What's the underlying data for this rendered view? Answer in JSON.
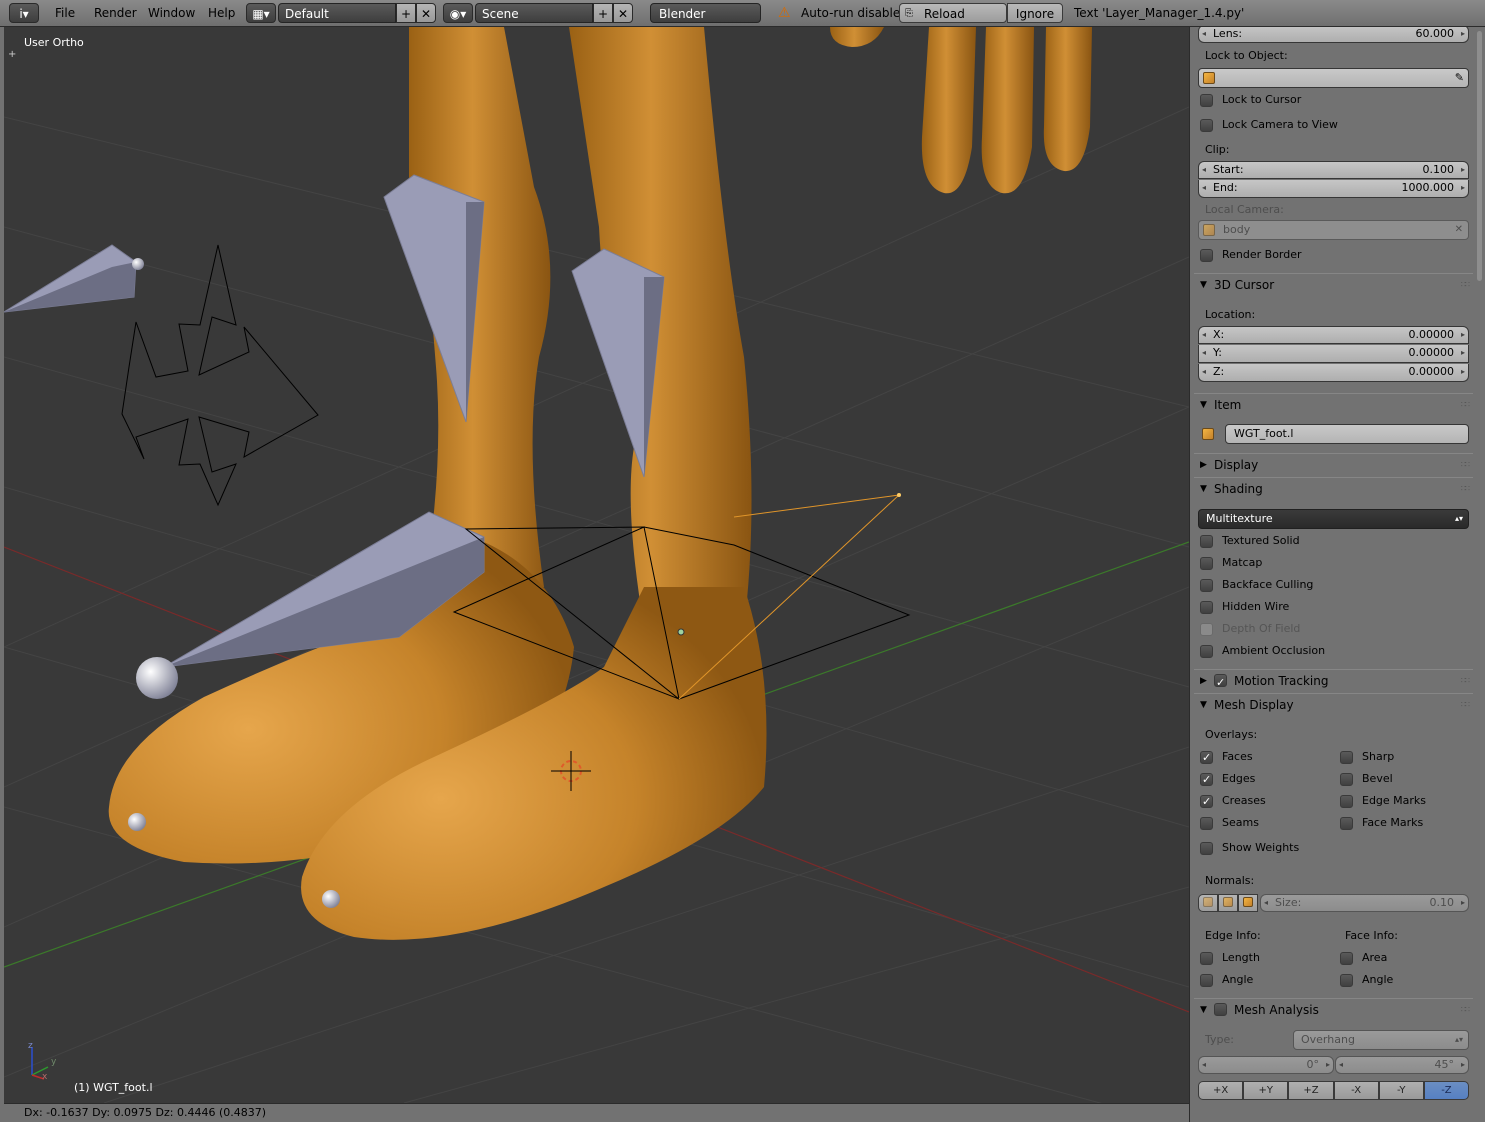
{
  "header": {
    "info_icon": "i",
    "menus": [
      "File",
      "Render",
      "Window",
      "Help"
    ],
    "screen_layout": "Default",
    "scene": "Scene",
    "render_engine": "Blender Render",
    "warning_text": "Auto-run disabled",
    "reload_trusted": "Reload Trusted",
    "ignore": "Ignore",
    "text_message": "Text 'Layer_Manager_1.4.py'"
  },
  "viewport": {
    "view_label": "User Ortho",
    "object_label": "(1) WGT_foot.l",
    "axis_y": "y",
    "axis_x": "x",
    "axis_z": "z",
    "status": "Dx: -0.1637  Dy: 0.0975  Dz: 0.4446 (0.4837)"
  },
  "properties": {
    "lens_label": "Lens:",
    "lens_value": "60.000",
    "lock_to_object_label": "Lock to Object:",
    "lock_to_cursor": "Lock to Cursor",
    "lock_camera_to_view": "Lock Camera to View",
    "clip_label": "Clip:",
    "clip_start_label": "Start:",
    "clip_start_value": "0.100",
    "clip_end_label": "End:",
    "clip_end_value": "1000.000",
    "local_camera_label": "Local Camera:",
    "local_camera_value": "body",
    "render_border": "Render Border",
    "cursor_section": "3D Cursor",
    "location_label": "Location:",
    "x_label": "X:",
    "x_value": "0.00000",
    "y_label": "Y:",
    "y_value": "0.00000",
    "z_label": "Z:",
    "z_value": "0.00000",
    "item_section": "Item",
    "item_name": "WGT_foot.l",
    "display_section": "Display",
    "shading_section": "Shading",
    "shading_mode": "Multitexture",
    "shading_options": [
      {
        "label": "Textured Solid",
        "checked": false,
        "disabled": false
      },
      {
        "label": "Matcap",
        "checked": false,
        "disabled": false
      },
      {
        "label": "Backface Culling",
        "checked": false,
        "disabled": false
      },
      {
        "label": "Hidden Wire",
        "checked": false,
        "disabled": false
      },
      {
        "label": "Depth Of Field",
        "checked": false,
        "disabled": true
      },
      {
        "label": "Ambient Occlusion",
        "checked": false,
        "disabled": false
      }
    ],
    "motion_tracking_section": "Motion Tracking",
    "mesh_display_section": "Mesh Display",
    "overlays_label": "Overlays:",
    "overlays_left": [
      {
        "label": "Faces",
        "checked": true
      },
      {
        "label": "Edges",
        "checked": true
      },
      {
        "label": "Creases",
        "checked": true
      },
      {
        "label": "Seams",
        "checked": false
      }
    ],
    "overlays_right": [
      {
        "label": "Sharp",
        "checked": false
      },
      {
        "label": "Bevel",
        "checked": false
      },
      {
        "label": "Edge Marks",
        "checked": false
      },
      {
        "label": "Face Marks",
        "checked": false
      }
    ],
    "show_weights": "Show Weights",
    "normals_label": "Normals:",
    "normals_size_label": "Size:",
    "normals_size_value": "0.10",
    "edge_info_label": "Edge Info:",
    "face_info_label": "Face Info:",
    "edge_length": "Length",
    "edge_angle": "Angle",
    "face_area": "Area",
    "face_angle": "Angle",
    "mesh_analysis_section": "Mesh Analysis",
    "type_label": "Type:",
    "type_value": "Overhang",
    "range_min": "0°",
    "range_max": "45°",
    "axis_buttons": [
      "+X",
      "+Y",
      "+Z",
      "-X",
      "-Y",
      "-Z"
    ],
    "active_axis": "-Z"
  },
  "colors": {
    "skin": "#c98a2e",
    "bone_widget": "#9a9cb6",
    "grid_x_axis": "#8a2a2a",
    "grid_y_axis": "#3a8a2a",
    "selected_wire": "#f0a030"
  }
}
